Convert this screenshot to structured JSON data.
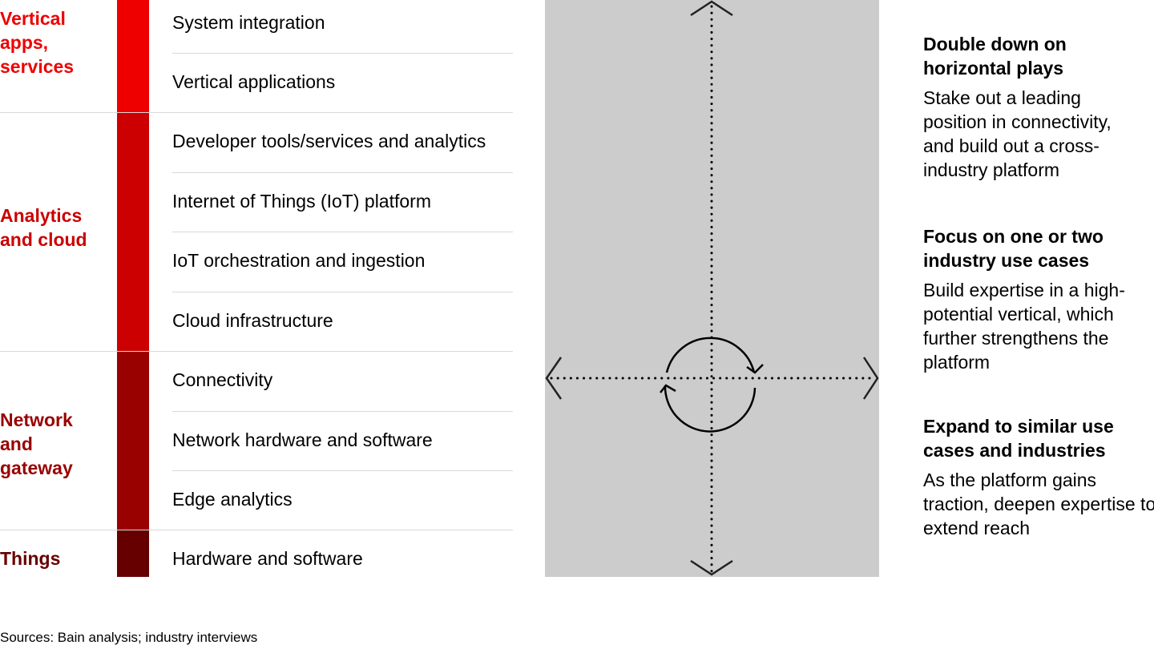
{
  "layers": [
    {
      "label": "Vertical apps, services",
      "lines": [
        "Vertical",
        "apps,",
        "services"
      ],
      "color": "#ee0000"
    },
    {
      "label": "Analytics and cloud",
      "lines": [
        "Analytics",
        "and cloud"
      ],
      "color": "#cc0000"
    },
    {
      "label": "Network and gateway",
      "lines": [
        "Network",
        "and",
        "gateway"
      ],
      "color": "#990000"
    },
    {
      "label": "Things",
      "lines": [
        "Things"
      ],
      "color": "#660000"
    }
  ],
  "rows": [
    "System integration",
    "Vertical applications",
    "Developer tools/services and analytics",
    "Internet of Things (IoT) platform",
    "IoT orchestration and ingestion",
    "Cloud infrastructure",
    "Connectivity",
    "Network hardware and software",
    "Edge analytics",
    "Hardware and software"
  ],
  "diagram": {
    "axes": [
      "vertical",
      "horizontal"
    ],
    "center_icon": "cycle-arrows-icon",
    "panel_color": "#cccccc"
  },
  "strategies": [
    {
      "title": "Double down on horizontal plays",
      "body": "Stake out a leading position in connectivity, and build out a cross-industry platform"
    },
    {
      "title": "Focus on one or two industry use cases",
      "body": "Build expertise in a high-potential vertical, which further strengthens the platform"
    },
    {
      "title": "Expand to similar use cases and industries",
      "body": "As the platform gains traction, deepen expertise to extend reach"
    }
  ],
  "source": "Sources: Bain analysis; industry interviews"
}
